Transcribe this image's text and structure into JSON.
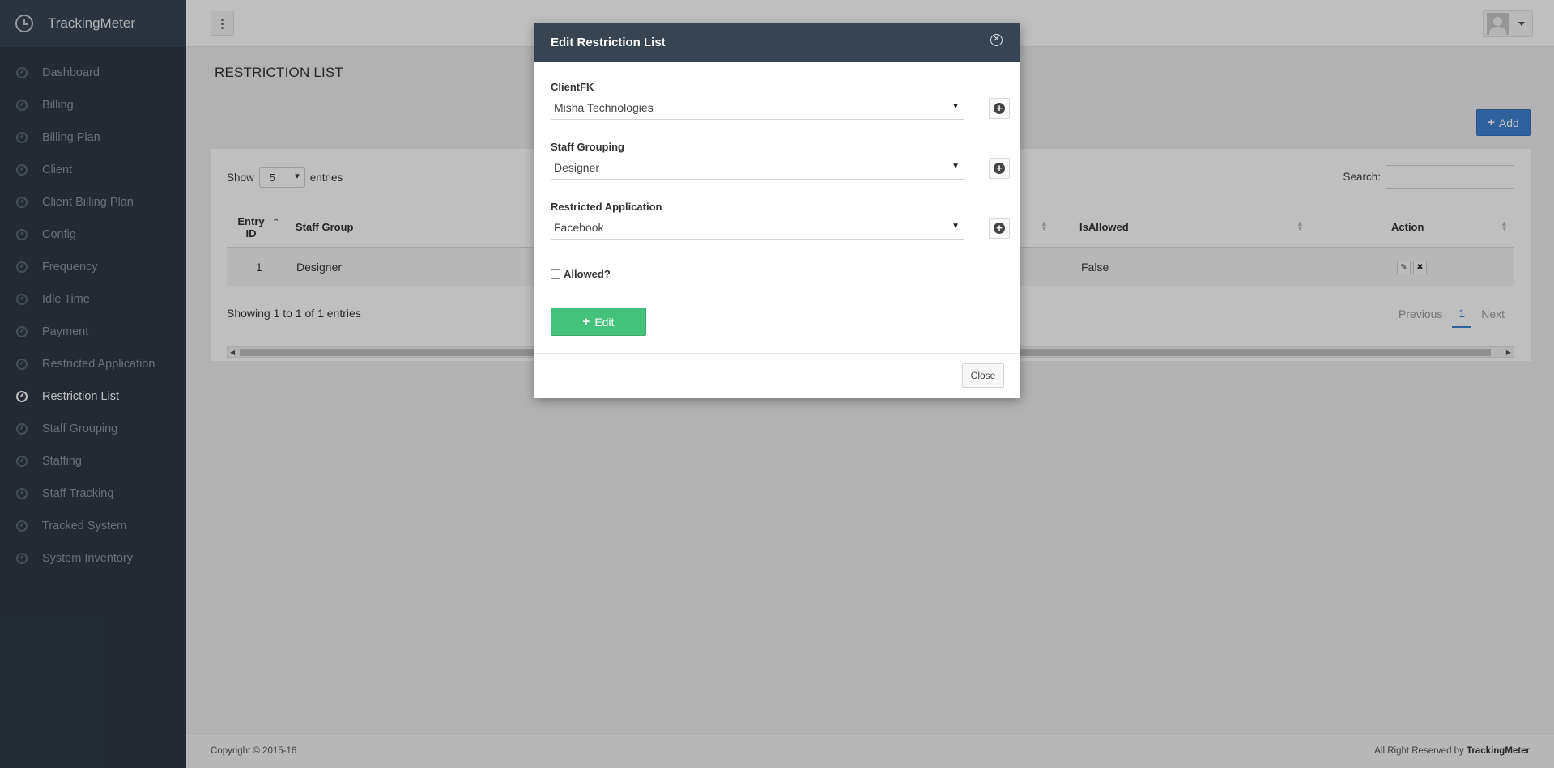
{
  "app": {
    "name": "TrackingMeter"
  },
  "sidebar": {
    "items": [
      {
        "label": "Dashboard"
      },
      {
        "label": "Billing"
      },
      {
        "label": "Billing Plan"
      },
      {
        "label": "Client"
      },
      {
        "label": "Client Billing Plan"
      },
      {
        "label": "Config"
      },
      {
        "label": "Frequency"
      },
      {
        "label": "Idle Time"
      },
      {
        "label": "Payment"
      },
      {
        "label": "Restricted Application"
      },
      {
        "label": "Restriction List"
      },
      {
        "label": "Staff Grouping"
      },
      {
        "label": "Staffing"
      },
      {
        "label": "Staff Tracking"
      },
      {
        "label": "Tracked System"
      },
      {
        "label": "System Inventory"
      }
    ],
    "active": "Restriction List"
  },
  "page": {
    "title": "RESTRICTION LIST",
    "add_label": "Add"
  },
  "table": {
    "show_label": "Show",
    "entries_label": "entries",
    "page_size": "5",
    "search_label": "Search:",
    "headers": {
      "entry_id_line1": "Entry",
      "entry_id_line2": "ID",
      "staff_group": "Staff Group",
      "is_allowed": "IsAllowed",
      "action": "Action"
    },
    "rows": [
      {
        "entry_id": "1",
        "staff_group": "Designer",
        "is_allowed": "False"
      }
    ],
    "info": "Showing 1 to 1 of 1 entries",
    "pager": {
      "previous": "Previous",
      "current": "1",
      "next": "Next"
    }
  },
  "modal": {
    "title": "Edit Restriction List",
    "fields": {
      "client": {
        "label": "ClientFK",
        "value": "Misha Technologies"
      },
      "staff_grouping": {
        "label": "Staff Grouping",
        "value": "Designer"
      },
      "restricted_application": {
        "label": "Restricted Application",
        "value": "Facebook"
      }
    },
    "allowed_label": "Allowed?",
    "allowed_checked": false,
    "submit_label": "Edit",
    "close_label": "Close"
  },
  "footer": {
    "copyright": "Copyright © 2015-16",
    "rights_prefix": "All Right Reserved by ",
    "rights_brand": "TrackingMeter"
  },
  "colors": {
    "sidebar": "#2f3946",
    "modal_header": "#394453",
    "primary": "#3f82d0",
    "success": "#44c17b"
  }
}
